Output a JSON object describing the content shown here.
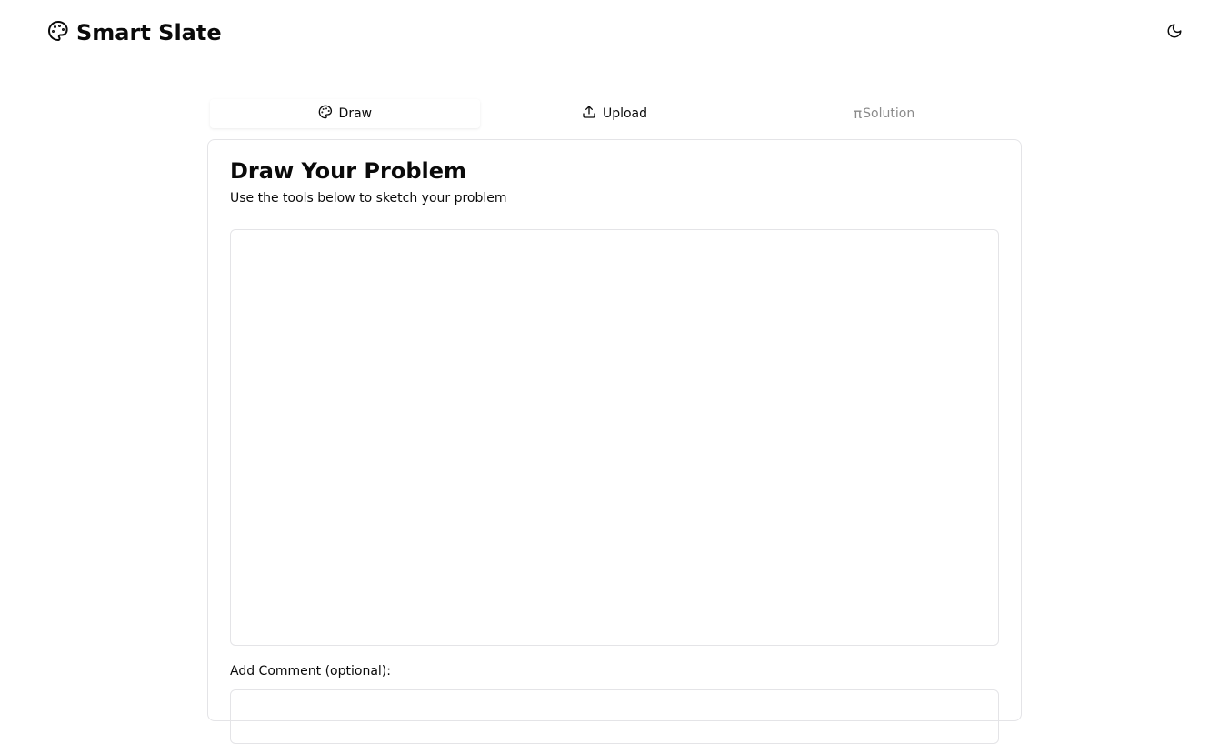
{
  "header": {
    "title": "Smart Slate",
    "logo_icon": "palette-icon",
    "theme_toggle_icon": "moon-icon"
  },
  "tabs": [
    {
      "label": "Draw",
      "icon": "palette-icon",
      "state": "active"
    },
    {
      "label": "Upload",
      "icon": "upload-icon",
      "state": "normal"
    },
    {
      "label": "Solution",
      "icon": "pi-icon",
      "state": "disabled"
    }
  ],
  "card": {
    "title": "Draw Your Problem",
    "subtitle": "Use the tools below to sketch your problem",
    "comment_label": "Add Comment (optional):"
  }
}
